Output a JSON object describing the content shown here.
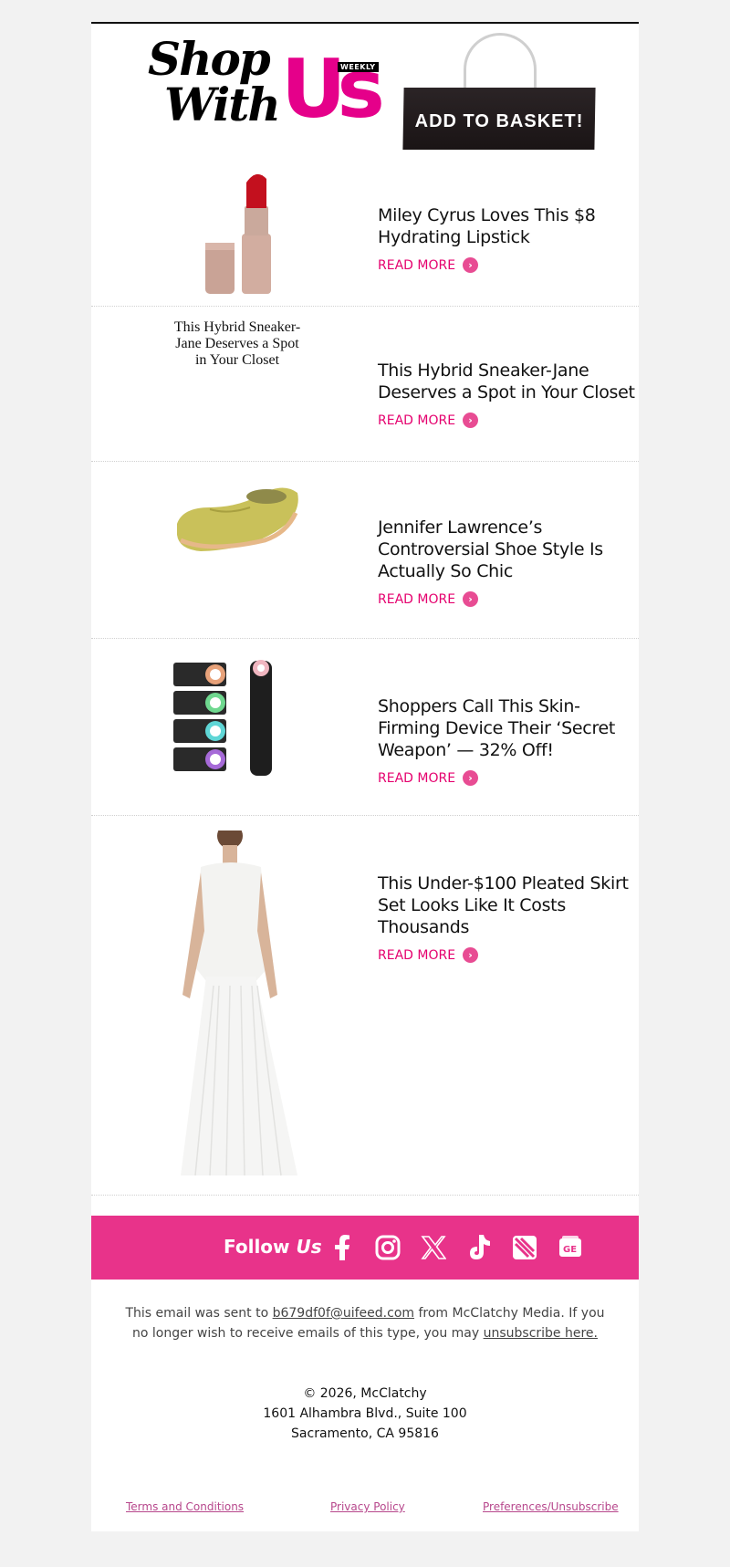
{
  "brand": {
    "logo_line1": "Shop",
    "logo_line2": "With",
    "logo_us": "Us",
    "logo_weekly": "WEEKLY",
    "basket_label": "ADD TO BASKET!"
  },
  "read_more_label": "READ MORE",
  "articles": [
    {
      "title": "Miley Cyrus Loves This $8 Hydrating Lipstick",
      "image": "lipstick-image"
    },
    {
      "title": "This Hybrid Sneaker-Jane Deserves a Spot in Your Closet",
      "image_alt": "This Hybrid Sneaker-Jane Deserves a Spot in Your Closet"
    },
    {
      "title": "Jennifer Lawrence’s Controversial Shoe Style Is Actually So Chic",
      "image": "loafer-image"
    },
    {
      "title": "Shoppers Call This Skin-Firming Device Their ‘Secret Weapon’ — 32% Off!",
      "image": "skin-device-image"
    },
    {
      "title": "This Under-$100 Pleated Skirt Set Looks Like It Costs Thousands",
      "image": "white-dress-image"
    }
  ],
  "follow": {
    "label": "Follow",
    "label_us": "Us",
    "icons": [
      "facebook-icon",
      "instagram-icon",
      "x-icon",
      "tiktok-icon",
      "apple-news-icon",
      "google-news-icon"
    ]
  },
  "footer": {
    "sent_prefix": "This email was sent to",
    "email": "b679df0f@uifeed.com",
    "sent_suffix": "from McClatchy Media. If you no longer wish to receive emails of this type, you may",
    "unsubscribe_link": "unsubscribe here.",
    "copyright": "© 2026, McClatchy",
    "address_line1": "1601 Alhambra Blvd., Suite 100",
    "address_line2": "Sacramento, CA 95816",
    "links": [
      "Terms and Conditions",
      "Privacy Policy",
      "Preferences/Unsubscribe"
    ]
  },
  "colors": {
    "brand_pink": "#e5008a",
    "follow_bar": "#e8338a",
    "link_pink": "#e5006e"
  }
}
